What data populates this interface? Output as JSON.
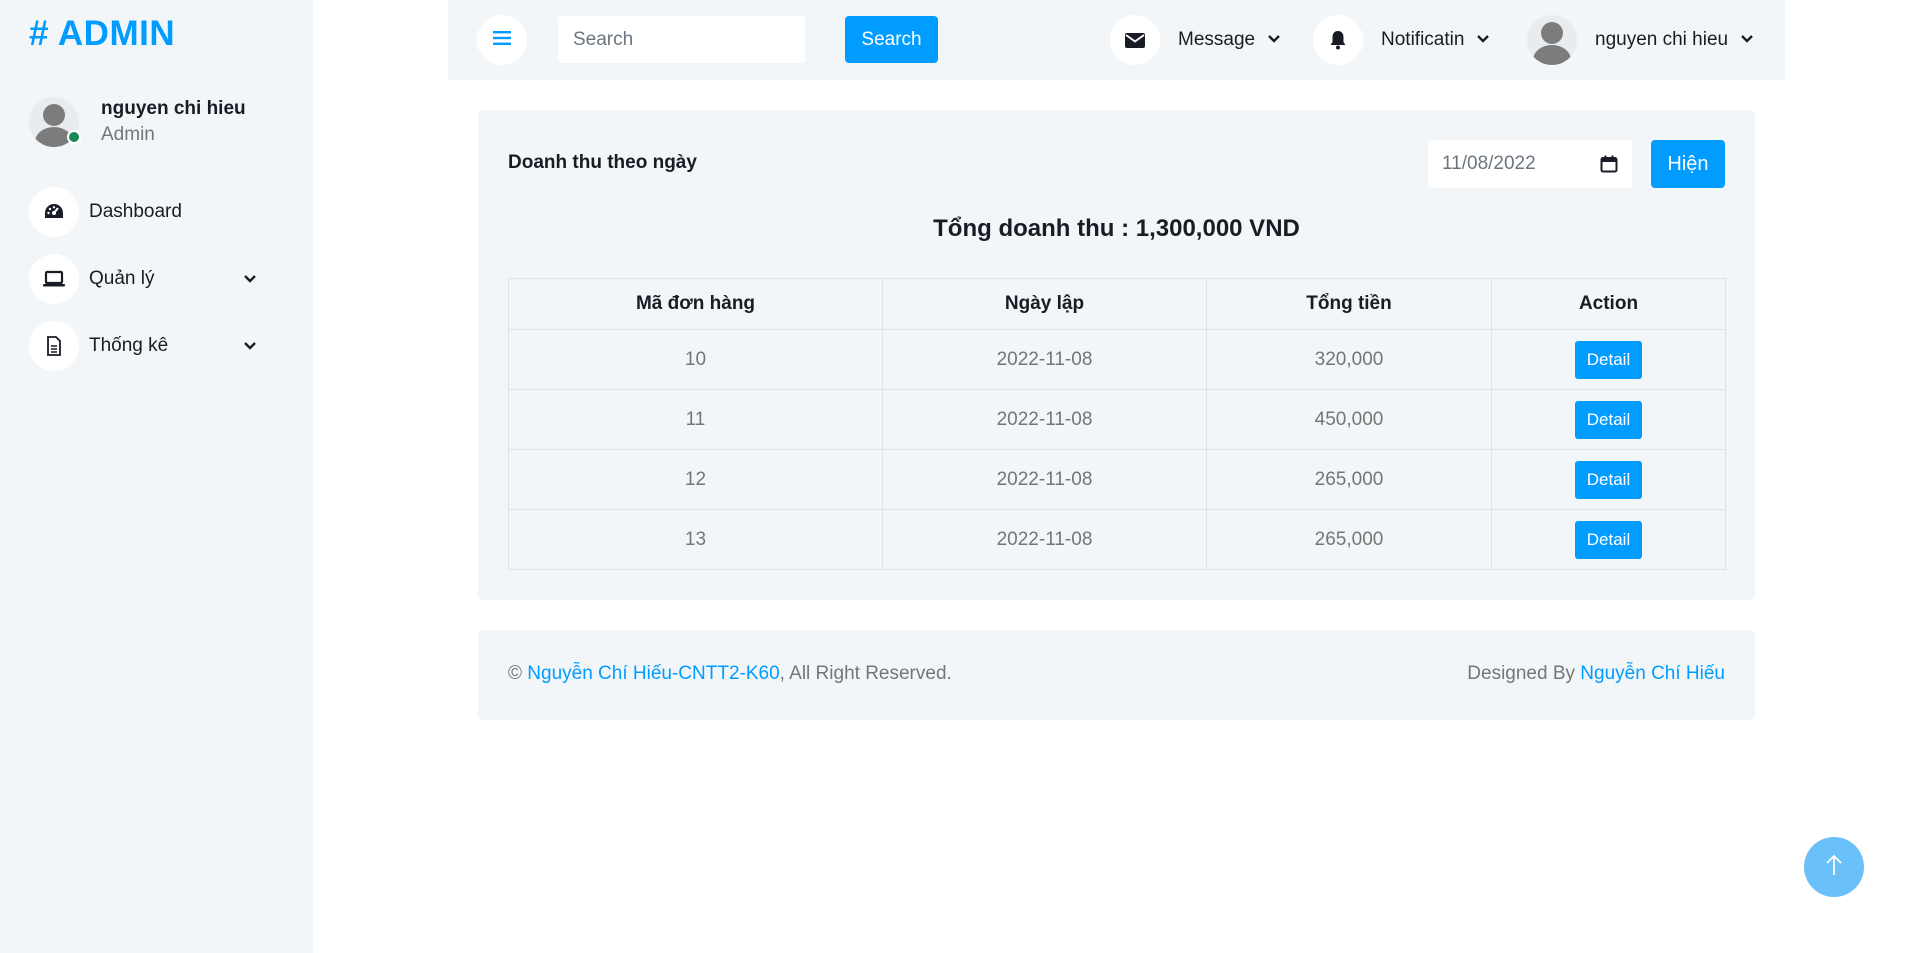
{
  "sidebar": {
    "brand": "# ADMIN",
    "user": {
      "name": "nguyen chi hieu",
      "role": "Admin",
      "status": "online"
    },
    "items": [
      {
        "label": "Dashboard",
        "icon": "dashboard-gauge-icon",
        "has_submenu": false
      },
      {
        "label": "Quản lý",
        "icon": "laptop-icon",
        "has_submenu": true
      },
      {
        "label": "Thống kê",
        "icon": "document-icon",
        "has_submenu": true
      }
    ]
  },
  "topbar": {
    "menu_icon": "bars-icon",
    "search_placeholder": "Search",
    "search_button": "Search",
    "message_label": "Message",
    "notification_label": "Notificatin",
    "user_name": "nguyen chi hieu"
  },
  "report": {
    "title": "Doanh thu theo ngày",
    "date_value": "11/08/2022",
    "show_button": "Hiện",
    "total": "Tổng doanh thu : 1,300,000 VND",
    "columns": [
      "Mã đơn hàng",
      "Ngày lập",
      "Tổng tiền",
      "Action"
    ],
    "rows": [
      {
        "id": "10",
        "date": "2022-11-08",
        "amount": "320,000",
        "action": "Detail"
      },
      {
        "id": "11",
        "date": "2022-11-08",
        "amount": "450,000",
        "action": "Detail"
      },
      {
        "id": "12",
        "date": "2022-11-08",
        "amount": "265,000",
        "action": "Detail"
      },
      {
        "id": "13",
        "date": "2022-11-08",
        "amount": "265,000",
        "action": "Detail"
      }
    ]
  },
  "footer": {
    "copyright_symbol": "©",
    "author_link": "Nguyễn Chí Hiếu-CNTT2-K60",
    "rights": ", All Right Reserved.",
    "designed_by": "Designed By",
    "designer_link": "Nguyễn Chí Hiếu"
  },
  "colors": {
    "accent": "#009cff",
    "panel": "#f3f6f9",
    "back_to_top": "#6ac1fa",
    "online": "#198754"
  }
}
